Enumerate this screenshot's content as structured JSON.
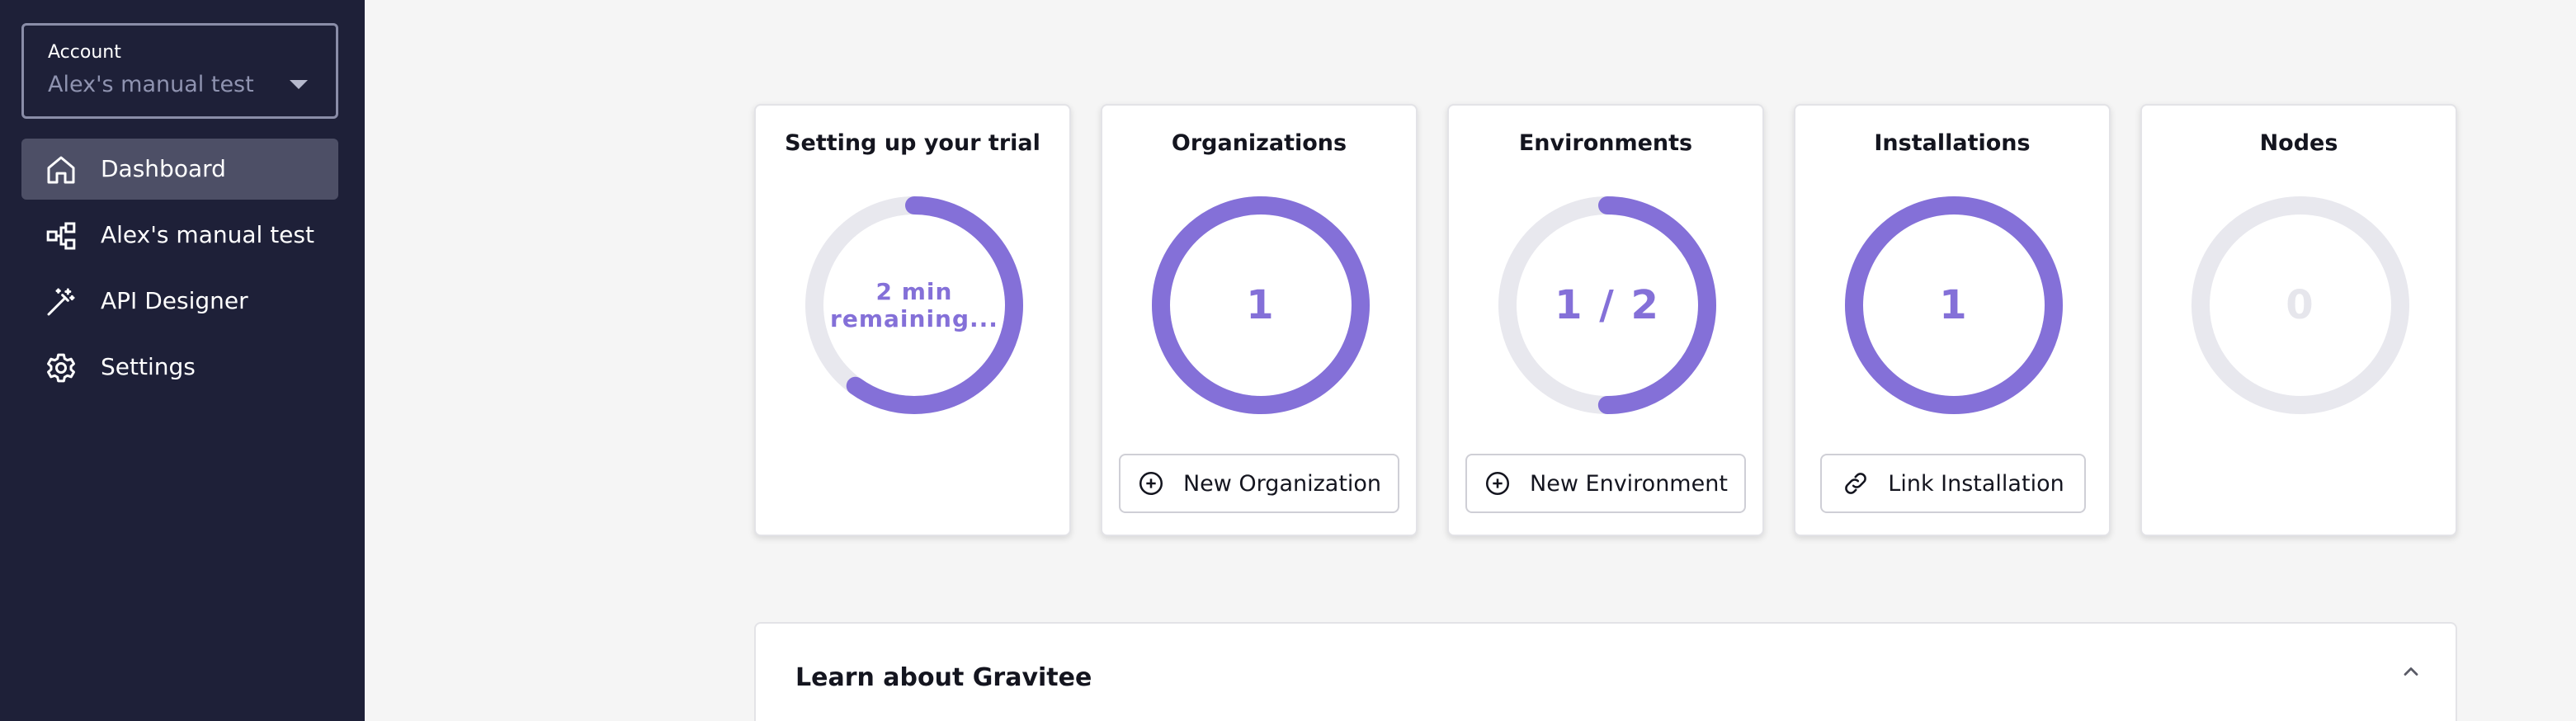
{
  "sidebar": {
    "account": {
      "label": "Account",
      "value": "Alex's manual test"
    },
    "items": [
      {
        "label": "Dashboard",
        "icon": "home-icon",
        "active": true
      },
      {
        "label": "Alex's manual test",
        "icon": "hierarchy-icon",
        "active": false
      },
      {
        "label": "API Designer",
        "icon": "magic-wand-icon",
        "active": false
      },
      {
        "label": "Settings",
        "icon": "gear-icon",
        "active": false
      }
    ]
  },
  "cards": [
    {
      "title": "Setting up your trial",
      "ring_text_line1": "2 min",
      "ring_text_line2": "remaining...",
      "progress": 0.6
    },
    {
      "title": "Organizations",
      "value": "1",
      "progress": 1.0,
      "button": "New Organization"
    },
    {
      "title": "Environments",
      "value": "1 / 2",
      "progress": 0.5,
      "button": "New Environment"
    },
    {
      "title": "Installations",
      "value": "1",
      "progress": 1.0,
      "button": "Link Installation"
    },
    {
      "title": "Nodes",
      "value": "0",
      "progress": 0
    }
  ],
  "learn": {
    "title": "Learn about Gravitee"
  },
  "colors": {
    "sidebar_bg": "#1e2038",
    "accent": "#8470d8",
    "ring_track": "#e8e8ee",
    "page_bg": "#f5f5f5"
  }
}
